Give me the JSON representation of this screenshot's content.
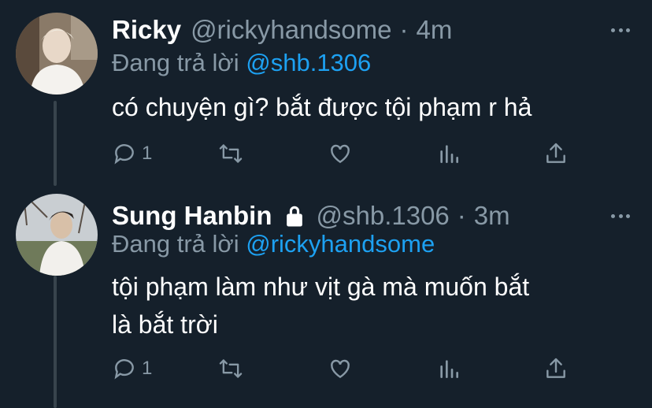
{
  "tweets": [
    {
      "name": "Ricky",
      "handle": "@rickyhandsome",
      "separator": "·",
      "time": "4m",
      "replying_label": "Đang trả lời",
      "replying_to": "@shb.1306",
      "text": "có chuyện gì? bắt được tội phạm r hả",
      "reply_count": "1",
      "protected": false
    },
    {
      "name": "Sung Hanbin",
      "handle": "@shb.1306",
      "separator": "·",
      "time": "3m",
      "replying_label": "Đang trả lời",
      "replying_to": "@rickyhandsome",
      "text_line1": "tội phạm làm như vịt gà mà muốn bắt",
      "text_line2": "là bắt trời",
      "reply_count": "1",
      "protected": true
    }
  ],
  "colors": {
    "background": "#15202b",
    "secondary_text": "#8899a6",
    "accent": "#1da1f2",
    "primary_text": "#ffffff"
  },
  "icons": [
    "reply-icon",
    "retweet-icon",
    "like-icon",
    "analytics-icon",
    "share-icon",
    "more-icon",
    "lock-icon"
  ]
}
